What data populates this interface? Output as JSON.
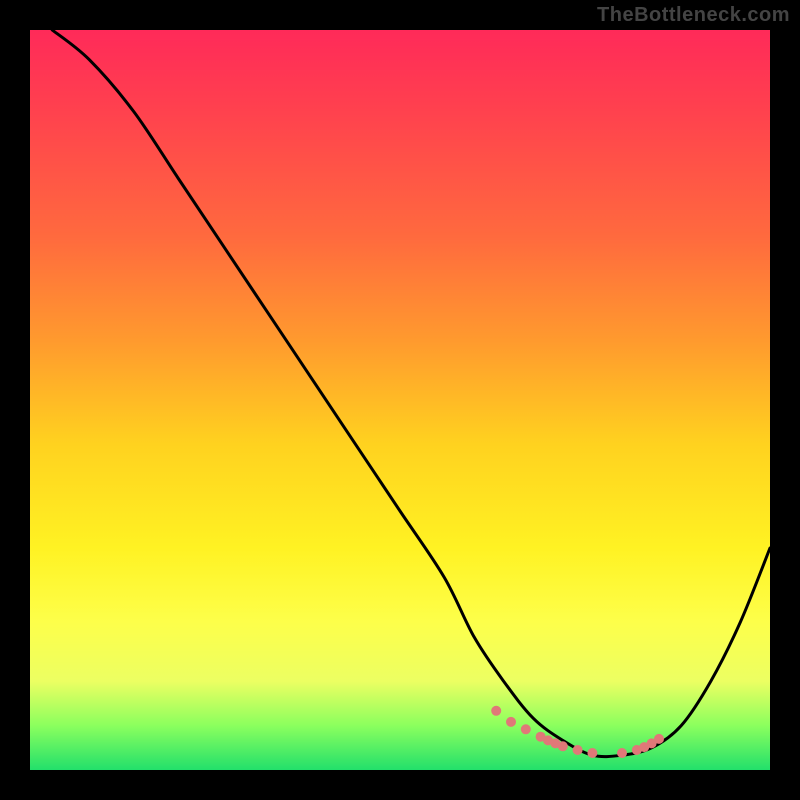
{
  "watermark": "TheBottleneck.com",
  "chart_data": {
    "type": "line",
    "title": "",
    "xlabel": "",
    "ylabel": "",
    "xlim": [
      0,
      100
    ],
    "ylim": [
      0,
      100
    ],
    "series": [
      {
        "name": "curve",
        "x": [
          3,
          8,
          14,
          20,
          26,
          32,
          38,
          44,
          50,
          56,
          60,
          64,
          68,
          72,
          76,
          80,
          84,
          88,
          92,
          96,
          100
        ],
        "values": [
          100,
          96,
          89,
          80,
          71,
          62,
          53,
          44,
          35,
          26,
          18,
          12,
          7,
          4,
          2,
          2,
          3,
          6,
          12,
          20,
          30
        ]
      }
    ],
    "markers": {
      "name": "highlight-dots",
      "color": "#e07878",
      "x": [
        63,
        65,
        67,
        69,
        70,
        71,
        72,
        74,
        76,
        80,
        82,
        83,
        84,
        85
      ],
      "y": [
        8,
        6.5,
        5.5,
        4.5,
        4,
        3.6,
        3.2,
        2.7,
        2.3,
        2.3,
        2.7,
        3.1,
        3.6,
        4.2
      ]
    },
    "gradient_stops": [
      {
        "pos": 0,
        "color": "#ff2a59"
      },
      {
        "pos": 10,
        "color": "#ff3f4f"
      },
      {
        "pos": 28,
        "color": "#ff6a3e"
      },
      {
        "pos": 42,
        "color": "#ff9a2e"
      },
      {
        "pos": 56,
        "color": "#ffd21f"
      },
      {
        "pos": 70,
        "color": "#fff223"
      },
      {
        "pos": 80,
        "color": "#fdff4a"
      },
      {
        "pos": 88,
        "color": "#ecff62"
      },
      {
        "pos": 94,
        "color": "#8bff5e"
      },
      {
        "pos": 100,
        "color": "#22e06b"
      }
    ]
  }
}
